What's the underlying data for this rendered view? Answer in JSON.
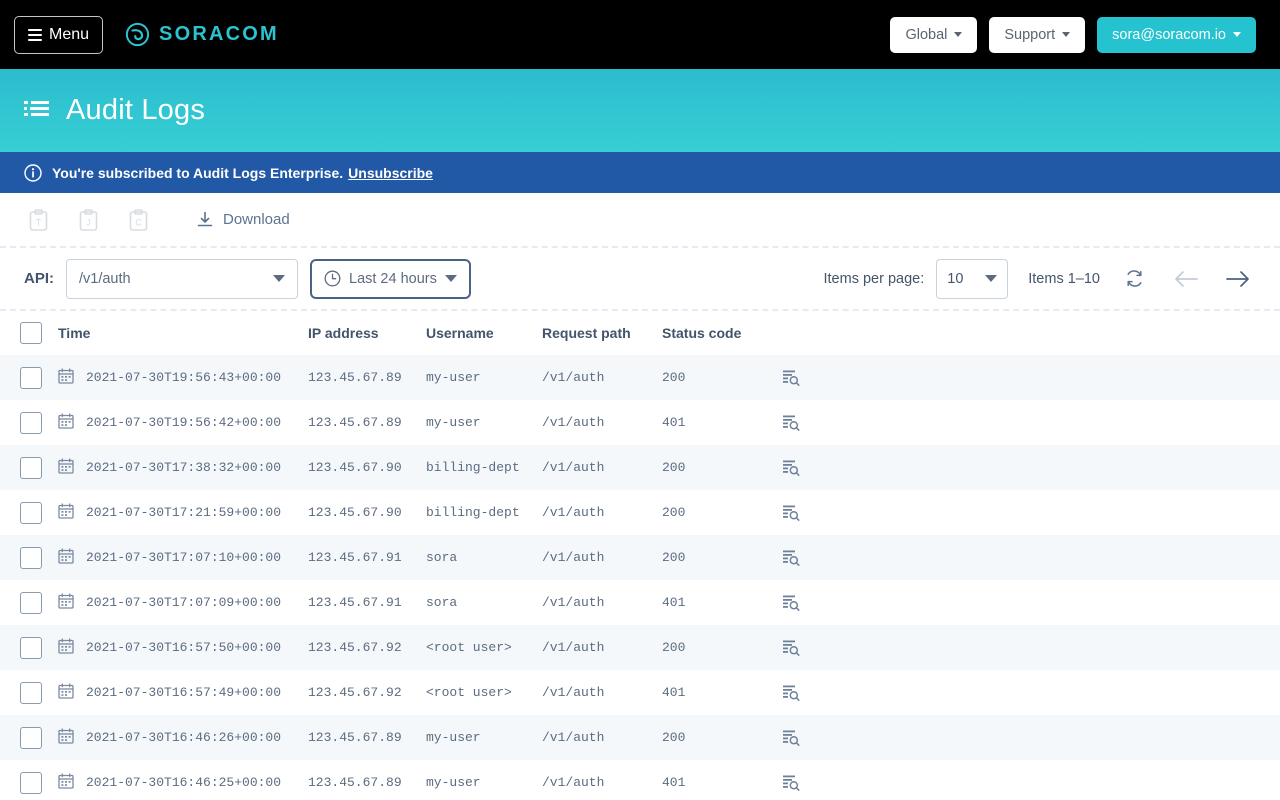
{
  "topnav": {
    "menu_label": "Menu",
    "brand": "SORACOM",
    "brand_color": "#2bc3cf",
    "coverage_label": "Global",
    "support_label": "Support",
    "account_label": "sora@soracom.io",
    "account_bg": "#24c3cf"
  },
  "header": {
    "title": "Audit Logs",
    "bg_color": "#2bbcce"
  },
  "banner": {
    "text": "You're subscribed to Audit Logs Enterprise.",
    "link_label": "Unsubscribe",
    "bg_color": "#2259a6"
  },
  "toolbar": {
    "copy_tsv_title": "Copy as TSV",
    "copy_json_title": "Copy as JSON",
    "copy_csv_title": "Copy to clipboard",
    "download_label": "Download"
  },
  "filters": {
    "api_label": "API:",
    "api_value": "/v1/auth",
    "time_range_label": "Last 24 hours"
  },
  "pagination": {
    "items_per_page_label": "Items per page:",
    "items_per_page_value": "10",
    "items_range": "Items 1–10",
    "refresh_title": "Refresh",
    "prev_title": "Previous page",
    "next_title": "Next page"
  },
  "table": {
    "columns": [
      "Time",
      "IP address",
      "Username",
      "Request path",
      "Status code"
    ],
    "rows": [
      {
        "time": "2021-07-30T19:56:43+00:00",
        "ip": "123.45.67.89",
        "username": "my-user",
        "path": "/v1/auth",
        "status": "200"
      },
      {
        "time": "2021-07-30T19:56:42+00:00",
        "ip": "123.45.67.89",
        "username": "my-user",
        "path": "/v1/auth",
        "status": "401"
      },
      {
        "time": "2021-07-30T17:38:32+00:00",
        "ip": "123.45.67.90",
        "username": "billing-dept",
        "path": "/v1/auth",
        "status": "200"
      },
      {
        "time": "2021-07-30T17:21:59+00:00",
        "ip": "123.45.67.90",
        "username": "billing-dept",
        "path": "/v1/auth",
        "status": "200"
      },
      {
        "time": "2021-07-30T17:07:10+00:00",
        "ip": "123.45.67.91",
        "username": "sora",
        "path": "/v1/auth",
        "status": "200"
      },
      {
        "time": "2021-07-30T17:07:09+00:00",
        "ip": "123.45.67.91",
        "username": "sora",
        "path": "/v1/auth",
        "status": "401"
      },
      {
        "time": "2021-07-30T16:57:50+00:00",
        "ip": "123.45.67.92",
        "username": "<root user>",
        "path": "/v1/auth",
        "status": "200"
      },
      {
        "time": "2021-07-30T16:57:49+00:00",
        "ip": "123.45.67.92",
        "username": "<root user>",
        "path": "/v1/auth",
        "status": "401"
      },
      {
        "time": "2021-07-30T16:46:26+00:00",
        "ip": "123.45.67.89",
        "username": "my-user",
        "path": "/v1/auth",
        "status": "200"
      },
      {
        "time": "2021-07-30T16:46:25+00:00",
        "ip": "123.45.67.89",
        "username": "my-user",
        "path": "/v1/auth",
        "status": "401"
      }
    ]
  }
}
